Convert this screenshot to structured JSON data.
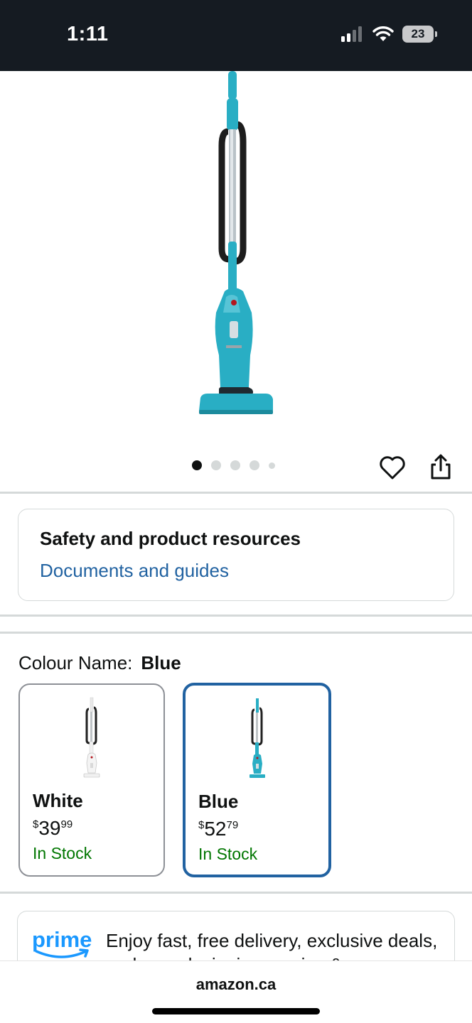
{
  "status_bar": {
    "time": "1:11",
    "battery": "23"
  },
  "carousel": {
    "total_images": 5,
    "active_index": 0
  },
  "resources": {
    "title": "Safety and product resources",
    "link": "Documents and guides"
  },
  "colour": {
    "label": "Colour Name:",
    "selected": "Blue",
    "options": [
      {
        "name": "White",
        "currency": "$",
        "price_whole": "39",
        "price_fraction": "99",
        "stock": "In Stock",
        "selected": false
      },
      {
        "name": "Blue",
        "currency": "$",
        "price_whole": "52",
        "price_fraction": "79",
        "stock": "In Stock",
        "selected": true
      }
    ]
  },
  "prime": {
    "logo": "prime",
    "text": "Enjoy fast, free delivery, exclusive deals, and award-winning movies &"
  },
  "browser": {
    "url": "amazon.ca"
  },
  "colors": {
    "link": "#2162a1",
    "in_stock": "#007600",
    "prime_blue": "#1a98ff",
    "vacuum_teal": "#29aec4"
  }
}
